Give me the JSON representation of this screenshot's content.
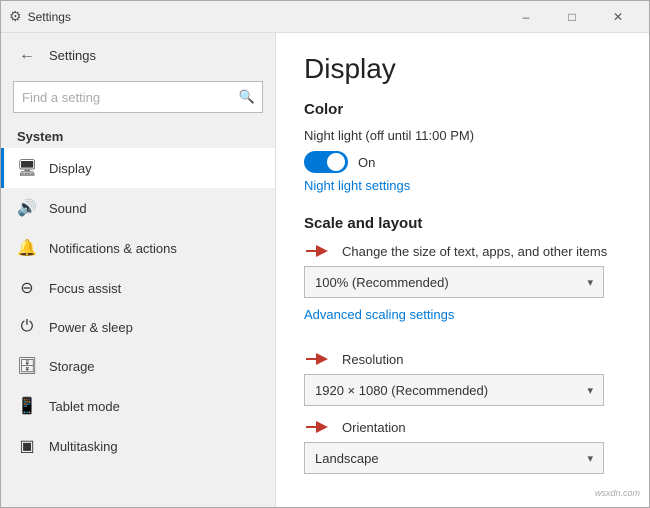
{
  "titleBar": {
    "title": "Settings",
    "minBtn": "–",
    "maxBtn": "□",
    "closeBtn": "✕"
  },
  "sidebar": {
    "backBtn": "←",
    "appTitle": "Settings",
    "search": {
      "placeholder": "Find a setting",
      "icon": "🔍"
    },
    "sectionLabel": "System",
    "navItems": [
      {
        "id": "display",
        "icon": "🖥",
        "label": "Display",
        "active": true
      },
      {
        "id": "sound",
        "icon": "🔊",
        "label": "Sound",
        "active": false
      },
      {
        "id": "notifications",
        "icon": "🔔",
        "label": "Notifications & actions",
        "active": false
      },
      {
        "id": "focus",
        "icon": "⊖",
        "label": "Focus assist",
        "active": false
      },
      {
        "id": "power",
        "icon": "⏻",
        "label": "Power & sleep",
        "active": false
      },
      {
        "id": "storage",
        "icon": "🗄",
        "label": "Storage",
        "active": false
      },
      {
        "id": "tablet",
        "icon": "📱",
        "label": "Tablet mode",
        "active": false
      },
      {
        "id": "multitasking",
        "icon": "▣",
        "label": "Multitasking",
        "active": false
      }
    ]
  },
  "rightPanel": {
    "pageTitle": "Display",
    "colorSection": {
      "title": "Color",
      "nightLightDesc": "Night light (off until 11:00 PM)",
      "toggleState": "On",
      "nightLightLink": "Night light settings"
    },
    "scaleSection": {
      "title": "Scale and layout",
      "sizeLabel": "Change the size of text, apps, and other items",
      "sizeDropdown": "100% (Recommended)",
      "advancedLink": "Advanced scaling settings",
      "resolutionLabel": "Resolution",
      "resolutionDropdown": "1920 × 1080 (Recommended)",
      "orientationLabel": "Orientation",
      "orientationDropdown": "Landscape"
    }
  },
  "watermark": "wsxdn.com"
}
